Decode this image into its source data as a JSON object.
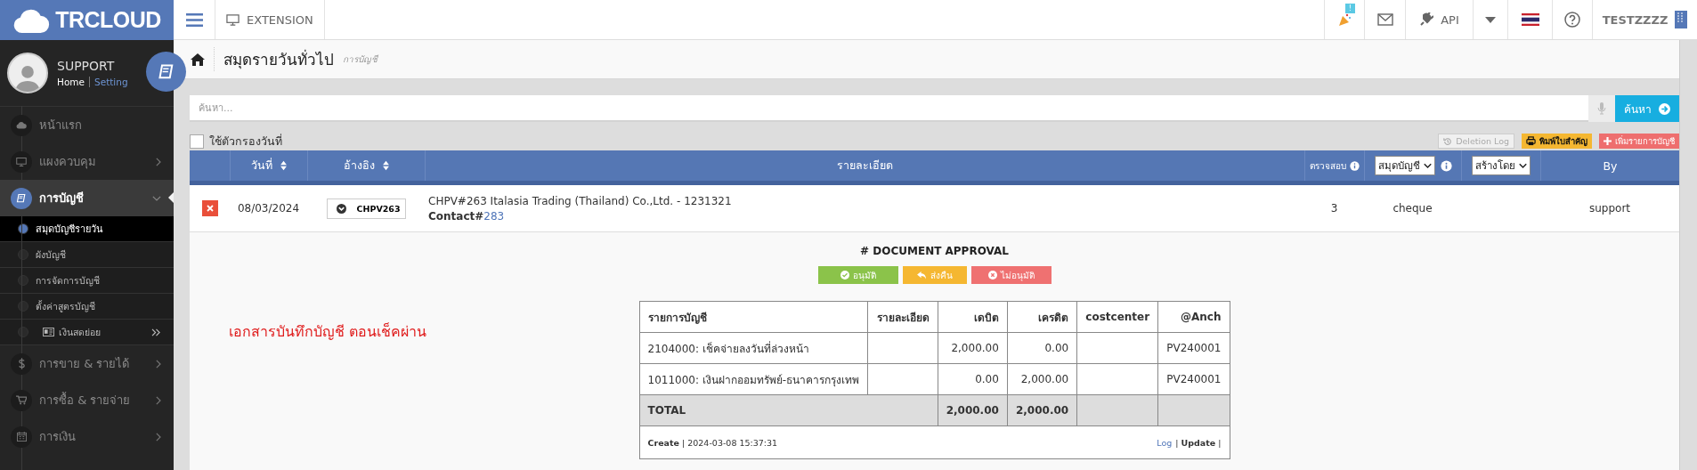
{
  "logo": {
    "text": "TRCLOUD"
  },
  "topbar": {
    "extension": "EXTENSION",
    "notification_badge": "!",
    "api": "API",
    "user": "TESTZZZZ"
  },
  "profile": {
    "name": "SUPPORT",
    "home_link": "Home",
    "setting_link": "Setting"
  },
  "sidebar": {
    "items": [
      {
        "label": "หน้าแรก",
        "kind": "link",
        "expanded": false
      },
      {
        "label": "แผงควบคุม",
        "kind": "menu",
        "expanded": false
      },
      {
        "label": "การบัญชี",
        "kind": "menu",
        "expanded": true,
        "children": [
          {
            "label": "สมุดบัญชีรายวัน",
            "kind": "link",
            "selected": true
          },
          {
            "label": "ผังบัญชี",
            "kind": "link",
            "selected": false
          },
          {
            "label": "การจัดการบัญชี",
            "kind": "link",
            "selected": false
          },
          {
            "label": "ตั้งค่าสูตรบัญชี",
            "kind": "link",
            "selected": false
          },
          {
            "label": "เงินสดย่อย",
            "kind": "submenu",
            "selected": false
          }
        ]
      },
      {
        "label": "การขาย & รายได้",
        "kind": "menu",
        "expanded": false
      },
      {
        "label": "การซื้อ & รายจ่าย",
        "kind": "menu",
        "expanded": false
      },
      {
        "label": "การเงิน",
        "kind": "menu",
        "expanded": false
      }
    ]
  },
  "page": {
    "title": "สมุดรายวันทั่วไป",
    "breadcrumb": "การบัญชี"
  },
  "search": {
    "placeholder": "ค้นหา...",
    "button": "ค้นหา"
  },
  "date_filter": {
    "label": "ใช้ตัวกรองวันที่",
    "checked": false
  },
  "actions": [
    {
      "label": "Deletion Log",
      "kind": "log"
    },
    {
      "label": "พิมพ์ใบสำคัญ",
      "kind": "print"
    },
    {
      "label": "เพิ่มรายการบัญชี",
      "kind": "add"
    }
  ],
  "table": {
    "columns": [
      {
        "kind": "blank"
      },
      {
        "label": "วันที่",
        "kind": "sortable"
      },
      {
        "label": "อ้างอิง",
        "kind": "sortable"
      },
      {
        "label": "รายละเอียด",
        "kind": "plain"
      },
      {
        "label": "ตรวจสอบ",
        "kind": "info"
      },
      {
        "label": "สมุดบัญชี",
        "kind": "select_info"
      },
      {
        "label": "สร้างโดย",
        "kind": "select"
      },
      {
        "label": "By",
        "kind": "plain"
      }
    ],
    "rows": [
      {
        "date": "08/03/2024",
        "reference": "CHPV263",
        "description": "CHPV#263 Italasia Trading (Thailand) Co.,Ltd. - 1231321",
        "contact_label": "Contact#",
        "contact_link": "283",
        "check": "3",
        "book": "cheque",
        "by": "support",
        "expanded": true,
        "detail": {
          "note": "เอกสารบันทึกบัญชี ตอนเช็คผ่าน",
          "approval_title": "# DOCUMENT APPROVAL",
          "approval_buttons": [
            {
              "label": "อนุมัติ",
              "kind": "approve"
            },
            {
              "label": "ส่งคืน",
              "kind": "return"
            },
            {
              "label": "ไม่อนุมัติ",
              "kind": "reject"
            }
          ],
          "entries": {
            "columns": [
              "รายการบัญชี",
              "รายละเอียด",
              "เดบิต",
              "เครดิต",
              "costcenter",
              "@Anch"
            ],
            "rows": [
              [
                "2104000: เช็คจ่ายลงวันที่ล่วงหน้า",
                "",
                "2,000.00",
                "0.00",
                "",
                "PV240001"
              ],
              [
                "1011000: เงินฝากออมทรัพย์-ธนาคารกรุงเทพ",
                "",
                "0.00",
                "2,000.00",
                "",
                "PV240001"
              ]
            ],
            "total": {
              "label": "TOTAL",
              "debit": "2,000.00",
              "credit": "2,000.00"
            }
          },
          "footer": {
            "created": "**Create** | 2024-03-08 15:37:31",
            "log_link": "Log",
            "update": "| **Update** |"
          }
        }
      }
    ]
  }
}
